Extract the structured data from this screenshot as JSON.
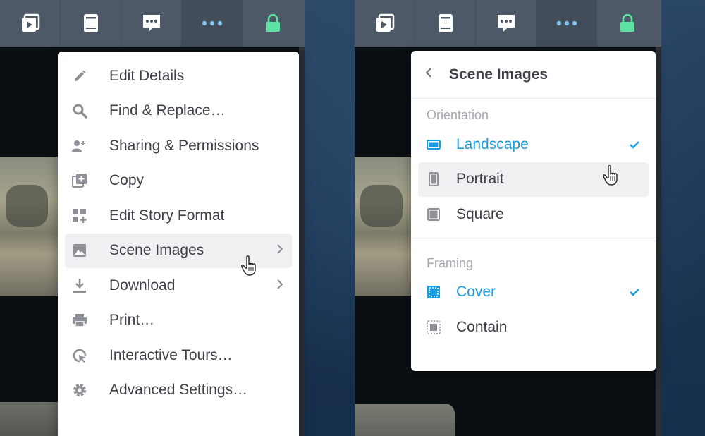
{
  "colors": {
    "accent": "#1a9de0",
    "toolbar": "#4d5966",
    "lock": "#5de3a4",
    "dots": "#7cc4ee"
  },
  "toolbar": {
    "buttons": [
      {
        "icon": "play-square-icon"
      },
      {
        "icon": "book-icon"
      },
      {
        "icon": "comment-icon"
      },
      {
        "icon": "more-dots-icon",
        "active": true
      },
      {
        "icon": "lock-icon"
      }
    ]
  },
  "main_menu": {
    "items": [
      {
        "label": "Edit Details",
        "icon": "pencil-icon"
      },
      {
        "label": "Find & Replace…",
        "icon": "search-icon"
      },
      {
        "label": "Sharing & Permissions",
        "icon": "add-user-icon"
      },
      {
        "label": "Copy",
        "icon": "copy-icon"
      },
      {
        "label": "Edit Story Format",
        "icon": "grid-plus-icon"
      },
      {
        "label": "Scene Images",
        "icon": "image-icon",
        "submenu": true,
        "hover": true
      },
      {
        "label": "Download",
        "icon": "download-icon",
        "submenu": true
      },
      {
        "label": "Print…",
        "icon": "printer-icon"
      },
      {
        "label": "Interactive Tours…",
        "icon": "tour-icon"
      },
      {
        "label": "Advanced Settings…",
        "icon": "gear-icon"
      }
    ]
  },
  "scene_images_menu": {
    "title": "Scene Images",
    "orientation": {
      "label": "Orientation",
      "options": [
        {
          "label": "Landscape",
          "selected": true
        },
        {
          "label": "Portrait",
          "hover": true
        },
        {
          "label": "Square"
        }
      ]
    },
    "framing": {
      "label": "Framing",
      "options": [
        {
          "label": "Cover",
          "selected": true
        },
        {
          "label": "Contain"
        }
      ]
    }
  }
}
